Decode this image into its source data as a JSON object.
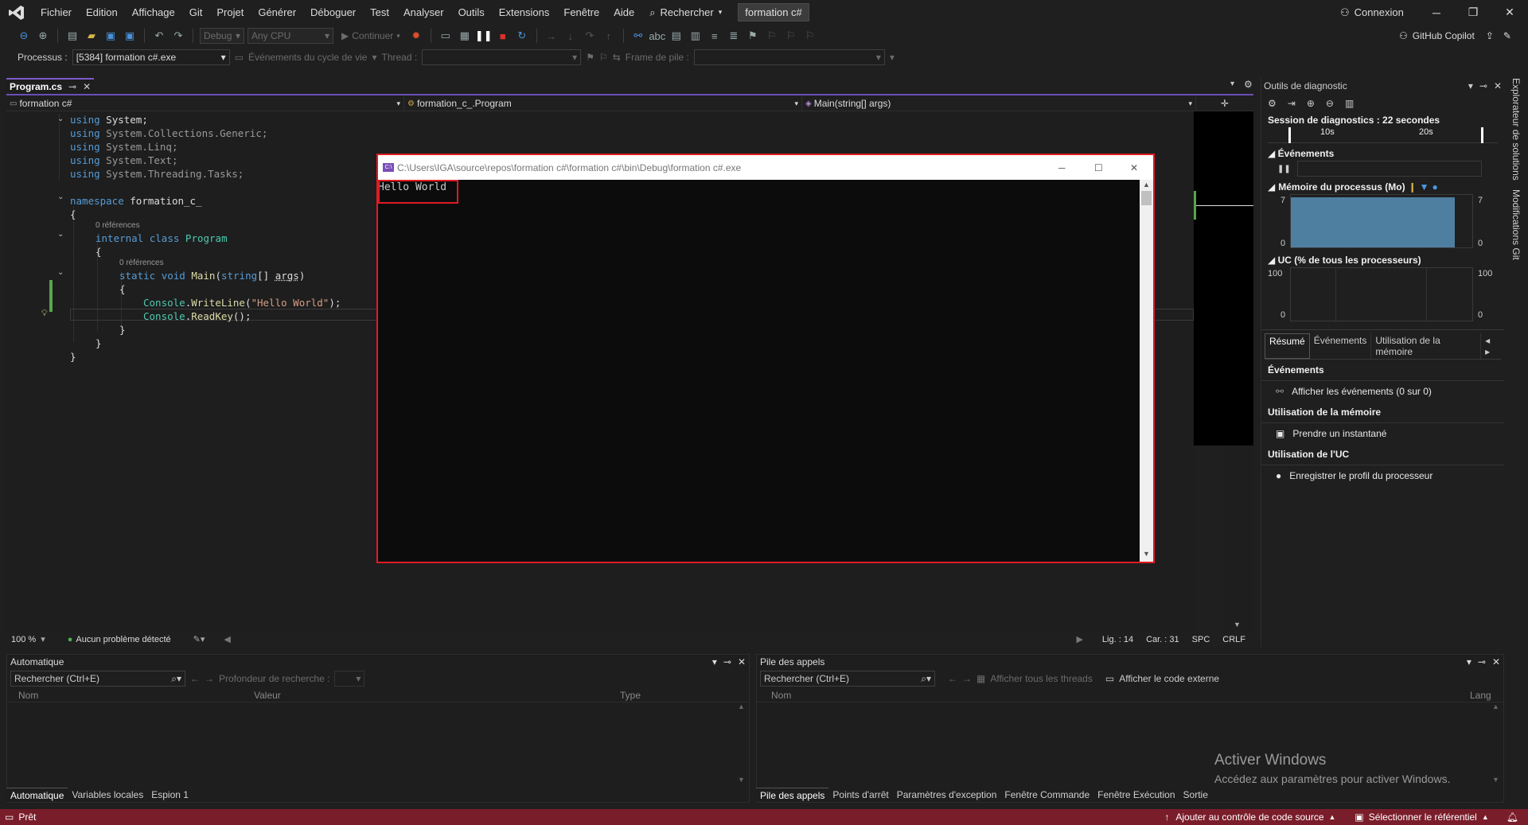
{
  "menu": [
    "Fichier",
    "Edition",
    "Affichage",
    "Git",
    "Projet",
    "Générer",
    "Déboguer",
    "Test",
    "Analyser",
    "Outils",
    "Extensions",
    "Fenêtre",
    "Aide"
  ],
  "search_label": "Rechercher",
  "solution_name": "formation c#",
  "connexion_label": "Connexion",
  "toolbar": {
    "config": "Debug",
    "platform": "Any CPU",
    "continue_label": "Continuer"
  },
  "copilot_label": "GitHub Copilot",
  "debug_location": {
    "process_label": "Processus :",
    "process_value": "[5384] formation c#.exe",
    "lifecycle_label": "Événements du cycle de vie",
    "thread_label": "Thread :",
    "frame_label": "Frame de pile :"
  },
  "editor": {
    "tab_label": "Program.cs",
    "nav_project": "formation c#",
    "nav_class": "formation_c_.Program",
    "nav_member": "Main(string[] args)",
    "codelens": "0 références",
    "zoom": "100 %",
    "problems": "Aucun problème détecté",
    "line": "Lig. : 14",
    "col": "Car. : 31",
    "whitespace": "SPC",
    "eol": "CRLF"
  },
  "code": {
    "using1": "System;",
    "using2": "System.Collections.Generic;",
    "using3": "System.Linq;",
    "using4": "System.Text;",
    "using5": "System.Threading.Tasks;",
    "kw_using": "using",
    "kw_namespace": "namespace",
    "ns_name": "formation_c_",
    "kw_internal": "internal",
    "kw_class": "class",
    "class_name": "Program",
    "kw_static": "static",
    "kw_void": "void",
    "method_name": "Main",
    "kw_string": "string",
    "param": "args",
    "console": "Console",
    "writeline": "WriteLine",
    "readkey": "ReadKey",
    "hello_literal": "\"Hello World\""
  },
  "console": {
    "title": "C:\\Users\\IGA\\source\\repos\\formation c#\\formation c#\\bin\\Debug\\formation c#.exe",
    "output": "Hello World"
  },
  "diag": {
    "title": "Outils de diagnostic",
    "session": "Session de diagnostics : 22 secondes",
    "tick1": "10s",
    "tick2": "20s",
    "events_title": "Événements",
    "memory_title": "Mémoire du processus (Mo)",
    "mem_max": "7",
    "mem_min": "0",
    "cpu_title": "UC (% de tous les processeurs)",
    "cpu_max": "100",
    "cpu_min": "0",
    "tabs": [
      "Résumé",
      "Événements",
      "Utilisation de la mémoire"
    ],
    "sec_events": "Événements",
    "show_events": "Afficher les événements (0 sur 0)",
    "sec_memory": "Utilisation de la mémoire",
    "snapshot": "Prendre un instantané",
    "sec_cpu": "Utilisation de l'UC",
    "record_cpu": "Enregistrer le profil du processeur",
    "memory_fill": 0.95
  },
  "vertical_tabs": [
    "Explorateur de solutions",
    "Modifications Git"
  ],
  "autos": {
    "title": "Automatique",
    "search": "Rechercher (Ctrl+E)",
    "depth_label": "Profondeur de recherche :",
    "col_name": "Nom",
    "col_value": "Valeur",
    "col_type": "Type",
    "tabs": [
      "Automatique",
      "Variables locales",
      "Espion 1"
    ]
  },
  "callstack": {
    "title": "Pile des appels",
    "search": "Rechercher (Ctrl+E)",
    "all_threads": "Afficher tous les threads",
    "external_code": "Afficher le code externe",
    "col_name": "Nom",
    "col_lang": "Lang",
    "tabs": [
      "Pile des appels",
      "Points d'arrêt",
      "Paramètres d'exception",
      "Fenêtre Commande",
      "Fenêtre Exécution",
      "Sortie"
    ]
  },
  "activate": {
    "title": "Activer Windows",
    "subtitle": "Accédez aux paramètres pour activer Windows."
  },
  "status": {
    "ready": "Prêt",
    "source_control": "Ajouter au contrôle de code source",
    "repo": "Sélectionner le référentiel"
  },
  "colors": {
    "status_bar": "#7a1d2a",
    "accent": "#6a4fb6",
    "highlight": "#e01b24",
    "chart_fill": "#4f7fa0"
  }
}
